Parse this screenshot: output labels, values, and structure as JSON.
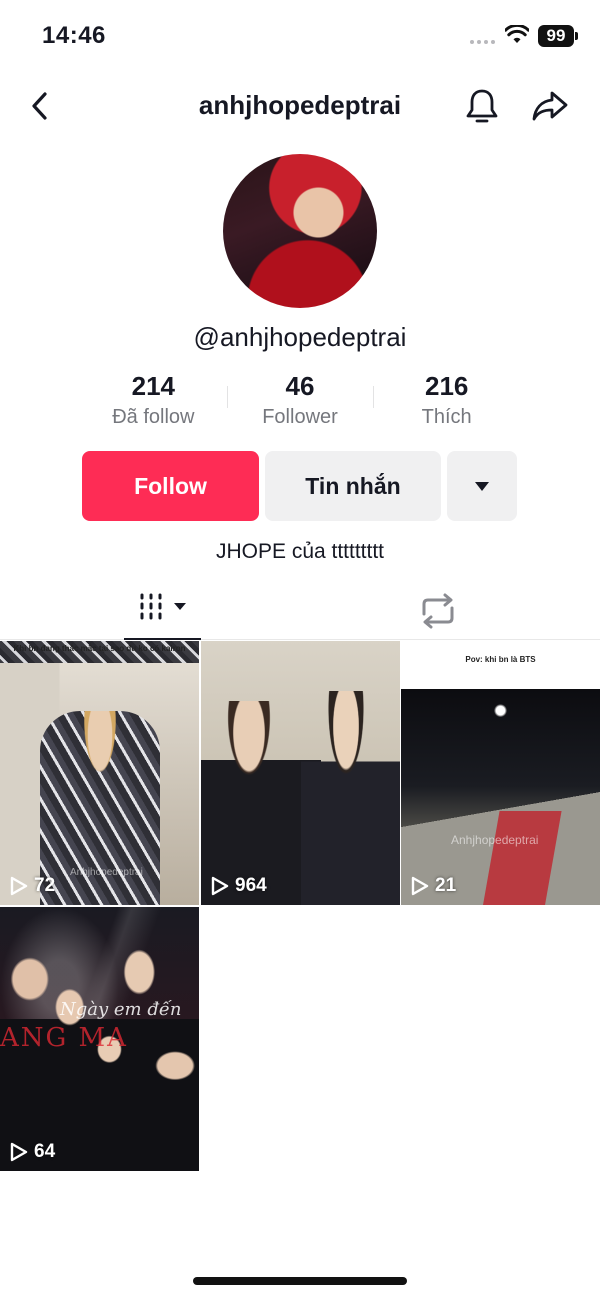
{
  "status_bar": {
    "time": "14:46",
    "battery": "99"
  },
  "header": {
    "title": "anhjhopedeptrai"
  },
  "profile": {
    "handle": "@anhjhopedeptrai",
    "bio": "JHOPE của ttttttttt",
    "stats": [
      {
        "value": "214",
        "label": "Đã follow"
      },
      {
        "value": "46",
        "label": "Follower"
      },
      {
        "value": "216",
        "label": "Thích"
      }
    ]
  },
  "actions": {
    "follow_label": "Follow",
    "message_label": "Tin nhắn"
  },
  "tabs": {
    "videos_icon": "grid-icon",
    "repost_icon": "repost-icon"
  },
  "videos": [
    {
      "views": "72",
      "caption": "Khi bn đang thắc mắc tại sao đu ko có kairon",
      "watermark": "Anhjhopedeptrai"
    },
    {
      "views": "964",
      "caption": "",
      "watermark": ""
    },
    {
      "views": "21",
      "caption": "Pov: khi bn là BTS",
      "watermark": "Anhjhopedeptrai"
    },
    {
      "views": "64",
      "caption": "",
      "watermark": "",
      "overlay_script": "Ngày em đến",
      "overlay_red": "ANG MA"
    }
  ],
  "colors": {
    "accent": "#fe2c55",
    "button_secondary": "#f0f0f1",
    "text_primary": "#161823",
    "text_secondary": "#75777d"
  }
}
